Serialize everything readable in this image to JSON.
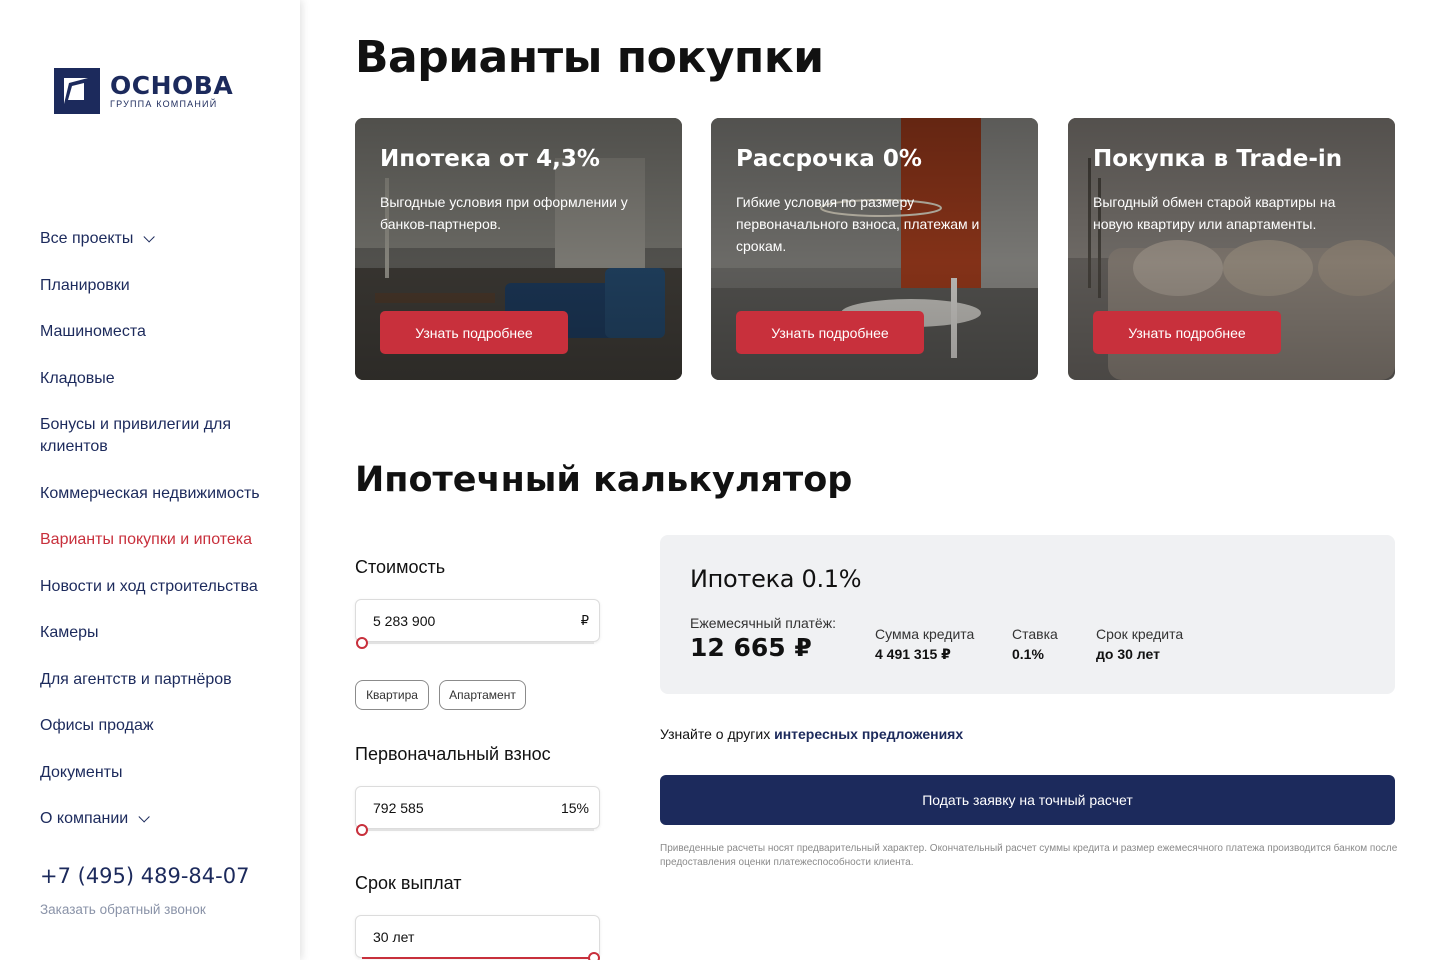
{
  "brand": {
    "name": "ОСНОВА",
    "subtitle": "ГРУППА КОМПАНИЙ",
    "color": "#1c2a5c"
  },
  "sidebar": {
    "items": [
      {
        "label": "Все проекты",
        "dropdown": true
      },
      {
        "label": "Планировки"
      },
      {
        "label": "Машиноместа"
      },
      {
        "label": "Кладовые"
      },
      {
        "label": "Бонусы и привилегии для клиентов"
      },
      {
        "label": "Коммерческая недвижимость"
      },
      {
        "label": "Варианты покупки и ипотека",
        "active": true
      },
      {
        "label": "Новости и ход строительства"
      },
      {
        "label": "Камеры"
      },
      {
        "label": "Для агентств и партнёров"
      },
      {
        "label": "Офисы продаж"
      },
      {
        "label": "Документы"
      },
      {
        "label": "О компании",
        "dropdown": true
      }
    ],
    "phone": "+7 (495) 489-84-07",
    "callback": "Заказать обратный звонок"
  },
  "main": {
    "title": "Варианты покупки",
    "cards": [
      {
        "title": "Ипотека от 4,3%",
        "desc": "Выгодные условия при оформлении у банков-партнеров.",
        "button": "Узнать подробнее"
      },
      {
        "title": "Рассрочка 0%",
        "desc": "Гибкие условия по размеру первоначального взноса, платежам и срокам.",
        "button": "Узнать подробнее"
      },
      {
        "title": "Покупка в Trade-in",
        "desc": "Выгодный обмен старой квартиры на новую квартиру или апартаменты.",
        "button": "Узнать подробнее"
      }
    ]
  },
  "calculator": {
    "title": "Ипотечный калькулятор",
    "cost": {
      "label": "Стоимость",
      "value": "5 283 900",
      "unit": "₽",
      "slider": 0
    },
    "types": [
      "Квартира",
      "Апартамент"
    ],
    "down_payment": {
      "label": "Первоначальный взнос",
      "value": "792 585",
      "percent": "15%",
      "slider": 0
    },
    "term": {
      "label": "Срок выплат",
      "value": "30 лет",
      "slider": 1
    },
    "result": {
      "title": "Ипотека 0.1%",
      "monthly_label": "Ежемесячный платёж:",
      "monthly_value": "12 665 ₽",
      "loan_label": "Сумма кредита",
      "loan_value": "4 491 315 ₽",
      "rate_label": "Ставка",
      "rate_value": "0.1%",
      "term_label": "Срок кредита",
      "term_value": "до 30 лет"
    },
    "offer_text": "Узнайте о других",
    "offer_link": "интересных предложениях",
    "submit": "Подать заявку на точный расчет",
    "disclaimer": "Приведенные расчеты носят предварительный характер. Окончательный расчет суммы кредита и размер ежемесячного платежа производится банком после предоставления оценки платежеспособности клиента."
  },
  "colors": {
    "accent": "#c8303c",
    "navy": "#1c2a5c",
    "panel": "#f0f1f3"
  }
}
